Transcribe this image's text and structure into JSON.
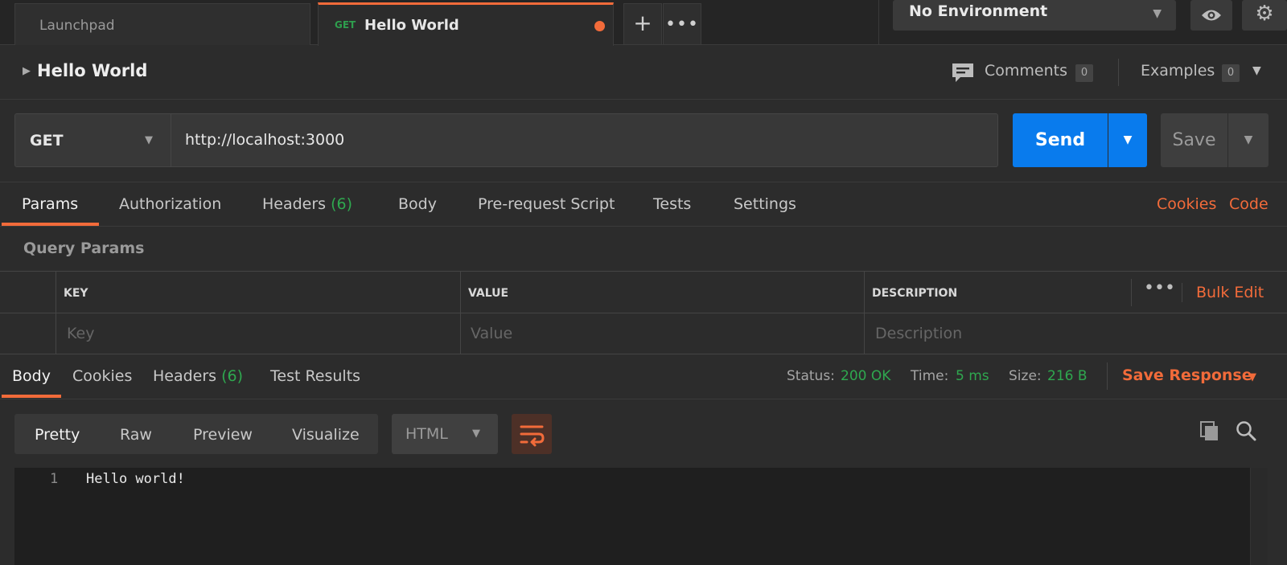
{
  "tabs": {
    "launchpad_label": "Launchpad",
    "active_method": "GET",
    "active_label": "Hello World"
  },
  "environment": {
    "selected": "No Environment"
  },
  "request": {
    "title": "Hello World",
    "comments_label": "Comments",
    "comments_count": "0",
    "examples_label": "Examples",
    "examples_count": "0",
    "method": "GET",
    "url": "http://localhost:3000",
    "send_label": "Send",
    "save_label": "Save"
  },
  "request_tabs": {
    "params": "Params",
    "authorization": "Authorization",
    "headers": "Headers",
    "headers_count": "(6)",
    "body": "Body",
    "prerequest": "Pre-request Script",
    "tests": "Tests",
    "settings": "Settings",
    "cookies": "Cookies",
    "code": "Code"
  },
  "query_params": {
    "label": "Query Params",
    "columns": [
      "KEY",
      "VALUE",
      "DESCRIPTION"
    ],
    "placeholders": [
      "Key",
      "Value",
      "Description"
    ],
    "bulk_edit": "Bulk Edit"
  },
  "response": {
    "tabs": {
      "body": "Body",
      "cookies": "Cookies",
      "headers": "Headers",
      "headers_count": "(6)",
      "test_results": "Test Results"
    },
    "status_label": "Status:",
    "status_value": "200 OK",
    "time_label": "Time:",
    "time_value": "5 ms",
    "size_label": "Size:",
    "size_value": "216 B",
    "save_response": "Save Response",
    "view_modes": [
      "Pretty",
      "Raw",
      "Preview",
      "Visualize"
    ],
    "language": "HTML",
    "line_number": "1",
    "body_text": "Hello world!"
  },
  "colors": {
    "accent": "#f26b3a",
    "send": "#097bed",
    "success": "#2fa84f",
    "background": "#2c2c2c"
  },
  "icons": [
    "caret-right-icon",
    "comment-icon",
    "chevron-down-icon",
    "eye-icon",
    "gear-icon",
    "plus-icon",
    "more-icon",
    "wrap-lines-icon",
    "copy-icon",
    "search-icon"
  ]
}
